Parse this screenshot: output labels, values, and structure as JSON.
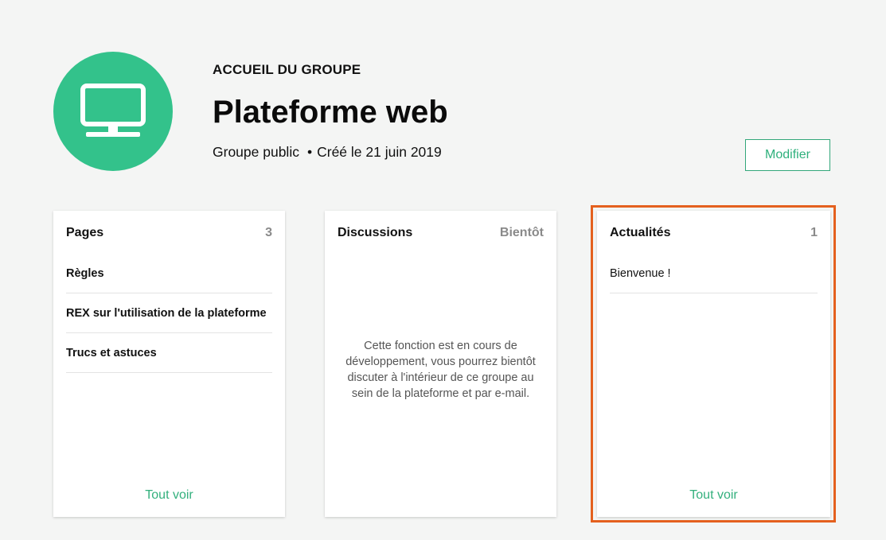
{
  "group": {
    "kicker": "ACCUEIL DU GROUPE",
    "title": "Plateforme web",
    "visibility": "Groupe public",
    "created": "Créé le 21 juin 2019",
    "avatar_icon": "monitor-icon",
    "accent_color": "#33c28b"
  },
  "actions": {
    "modify_label": "Modifier"
  },
  "cards": {
    "pages": {
      "title": "Pages",
      "count": "3",
      "items": [
        {
          "label": "Règles"
        },
        {
          "label": "REX sur l'utilisation de la plateforme"
        },
        {
          "label": "Trucs et astuces"
        }
      ],
      "footer": "Tout voir"
    },
    "discussions": {
      "title": "Discussions",
      "status": "Bientôt",
      "message": "Cette fonction est en cours de développement, vous pourrez bientôt discuter à l'intérieur de ce groupe au sein de la plateforme et par e-mail."
    },
    "news": {
      "title": "Actualités",
      "count": "1",
      "items": [
        {
          "label": "Bienvenue !"
        }
      ],
      "footer": "Tout voir"
    }
  },
  "highlight_color": "#e4601e"
}
